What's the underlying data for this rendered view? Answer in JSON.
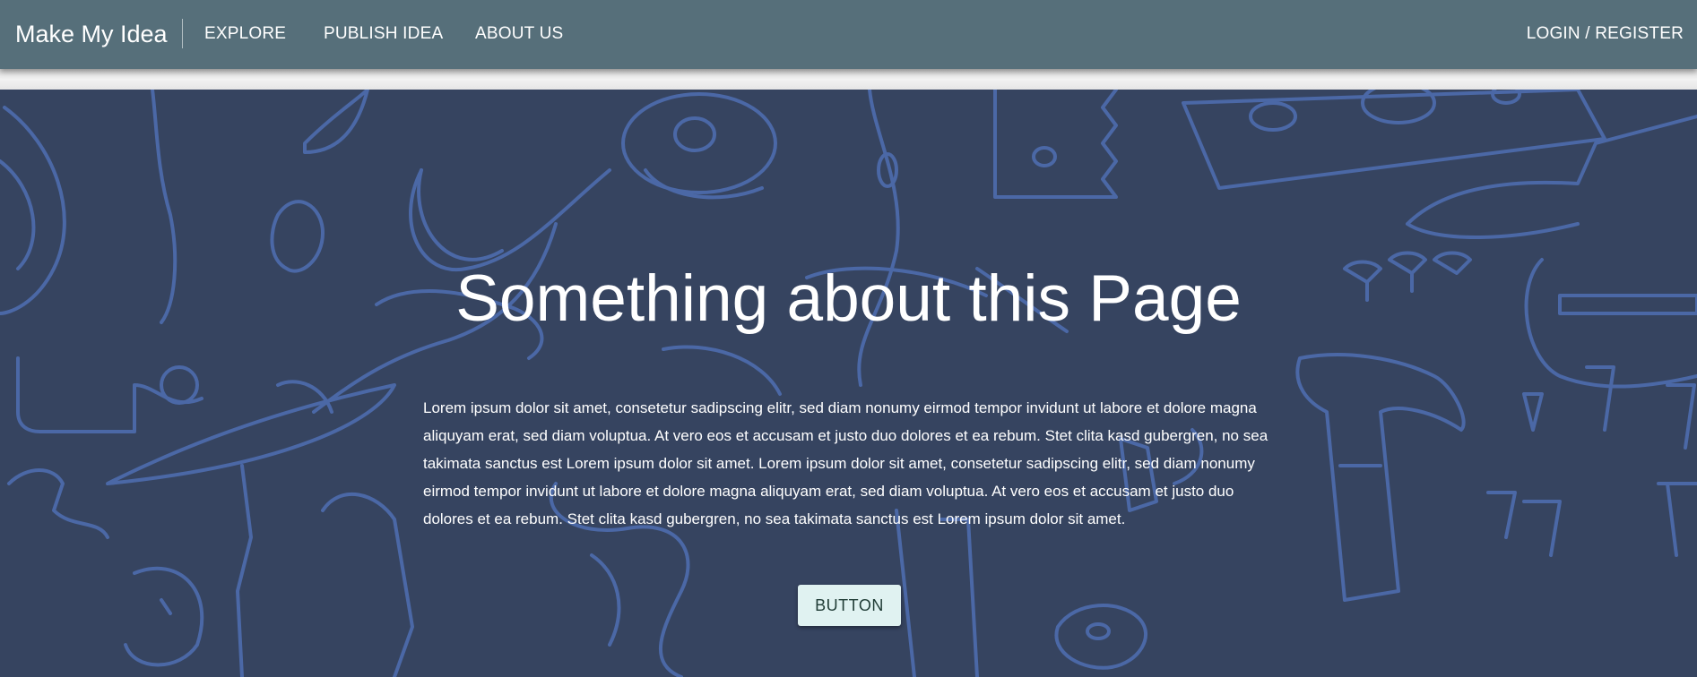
{
  "navbar": {
    "brand": "Make My Idea",
    "links": [
      {
        "label": "EXPLORE"
      },
      {
        "label": "PUBLISH IDEA"
      },
      {
        "label": "ABOUT US"
      }
    ],
    "login_label": "LOGIN / REGISTER"
  },
  "hero": {
    "title": "Something about this Page",
    "text": "Lorem ipsum dolor sit amet, consetetur sadipscing elitr, sed diam nonumy eirmod tempor invidunt ut labore et dolore magna aliquyam erat, sed diam voluptua. At vero eos et accusam et justo duo dolores et ea rebum. Stet clita kasd gubergren, no sea takimata sanctus est Lorem ipsum dolor sit amet. Lorem ipsum dolor sit amet, consetetur sadipscing elitr, sed diam nonumy eirmod tempor invidunt ut labore et dolore magna aliquyam erat, sed diam voluptua. At vero eos et accusam et justo duo dolores et ea rebum. Stet clita kasd gubergren, no sea takimata sanctus est Lorem ipsum dolor sit amet.",
    "button_label": "BUTTON",
    "background_pattern": "tools-doodle-pattern"
  },
  "colors": {
    "navbar": "#566f7a",
    "hero_background": "#364460",
    "doodle_stroke": "#4b68a6",
    "button_background": "#e0f2f1"
  }
}
